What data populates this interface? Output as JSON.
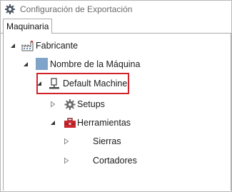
{
  "window": {
    "title": "Configuración de Exportación"
  },
  "tabs": [
    {
      "label": "Maquinaria"
    }
  ],
  "tree": {
    "root": {
      "label": "Fabricante",
      "expanded": true
    },
    "machine_name": {
      "label": "Nombre de la Máquina",
      "expanded": true
    },
    "default_machine": {
      "label": "Default Machine",
      "expanded": true,
      "highlighted": true
    },
    "setups": {
      "label": "Setups",
      "expanded": false
    },
    "tools": {
      "label": "Herramientas",
      "expanded": true
    },
    "saws": {
      "label": "Sierras",
      "expanded": false
    },
    "cutters": {
      "label": "Cortadores",
      "expanded": false
    }
  },
  "colors": {
    "highlight_border": "#d2232a",
    "toolbox_red": "#c9272d",
    "swatch_blue": "#7fa3c9"
  }
}
